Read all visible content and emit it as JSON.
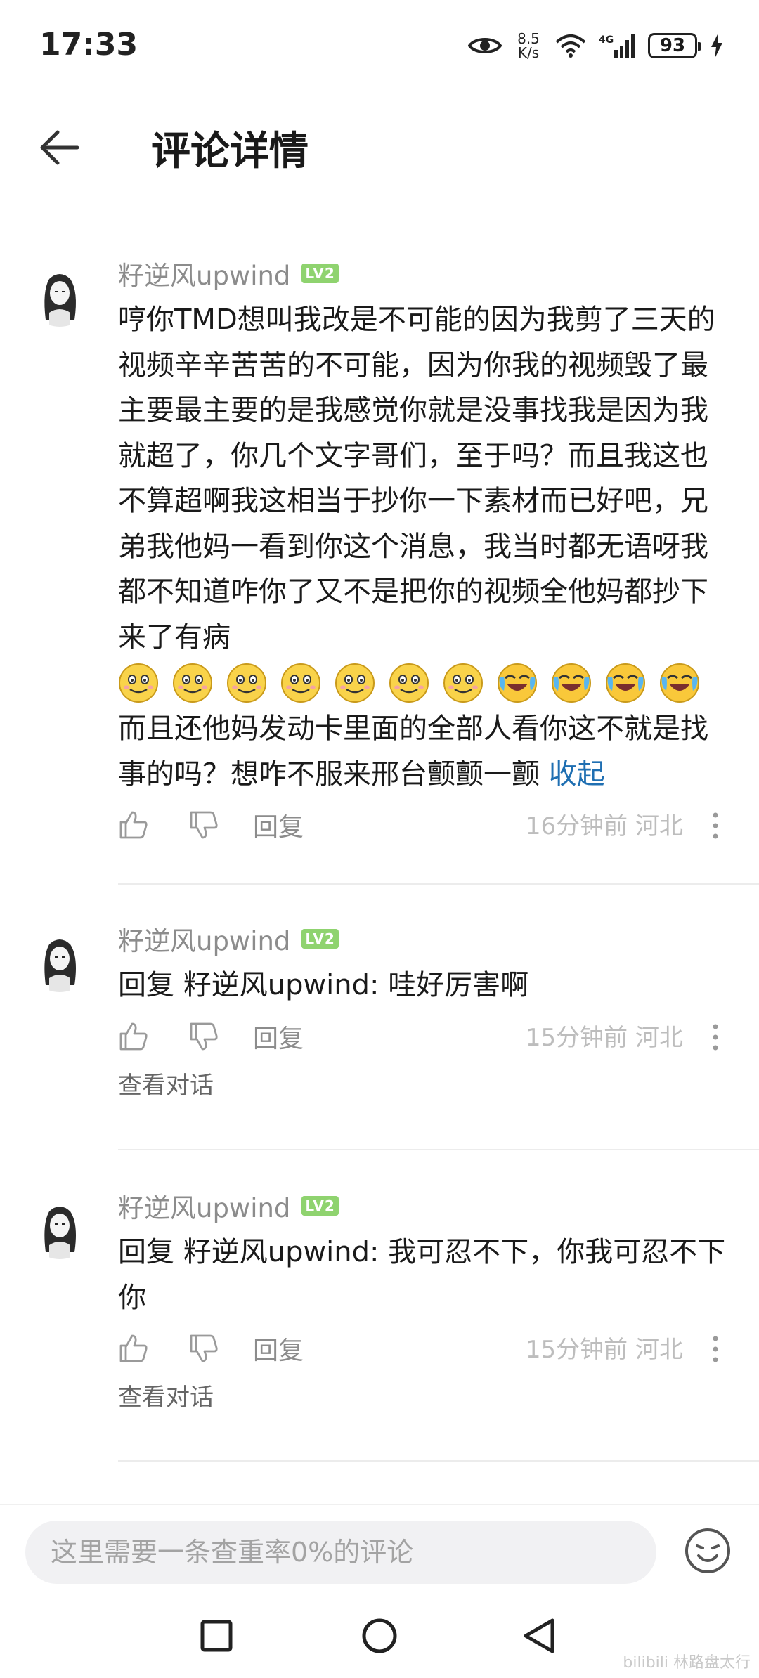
{
  "status_bar": {
    "time": "17:33",
    "net_speed_value": "8.5",
    "net_speed_unit": "K/s",
    "network": "4G",
    "battery": "93",
    "icons": [
      "eye-icon",
      "wifi-icon",
      "signal-icon",
      "battery-icon",
      "charging-icon"
    ]
  },
  "header": {
    "title": "评论详情",
    "back_icon": "back-arrow-icon"
  },
  "comments": [
    {
      "username": "籽逆风upwind",
      "level": "LV2",
      "text_before_emoji": "哼你TMD想叫我改是不可能的因为我剪了三天的视频辛辛苦苦的不可能，因为你我的视频毁了最主要最主要的是我感觉你就是没事找我是因为我就超了，你几个文字哥们，至于吗？而且我这也不算超啊我这相当于抄你一下素材而已好吧，兄弟我他妈一看到你这个消息，我当时都无语呀我都不知道咋你了又不是把你的视频全他妈都抄下来了有病",
      "emojis": [
        "smile",
        "smile",
        "smile",
        "smile",
        "smile",
        "smile",
        "smile",
        "cry-laugh",
        "cry-laugh",
        "cry-laugh",
        "cry-laugh"
      ],
      "text_after_emoji": "而且还他妈发动卡里面的全部人看你这不就是找事的吗？想咋不服来邢台颤颤一颤",
      "collapse_label": "收起",
      "reply_label": "回复",
      "meta": "16分钟前 河北"
    },
    {
      "username": "籽逆风upwind",
      "level": "LV2",
      "text": "回复 籽逆风upwind: 哇好厉害啊",
      "reply_label": "回复",
      "meta": "15分钟前 河北",
      "view_conversation": "查看对话"
    },
    {
      "username": "籽逆风upwind",
      "level": "LV2",
      "text": "回复 籽逆风upwind: 我可忍不下，你我可忍不下你",
      "reply_label": "回复",
      "meta": "15分钟前 河北",
      "view_conversation": "查看对话"
    }
  ],
  "input": {
    "placeholder": "这里需要一条查重率0%的评论"
  },
  "nav": {
    "buttons": [
      "recents-square-icon",
      "home-circle-icon",
      "back-triangle-icon"
    ]
  },
  "watermark": "bilibili 林路盘太行",
  "colors": {
    "level_badge": "#8fd36f",
    "link": "#1f6fb2",
    "muted_text": "#8c8c8c"
  }
}
